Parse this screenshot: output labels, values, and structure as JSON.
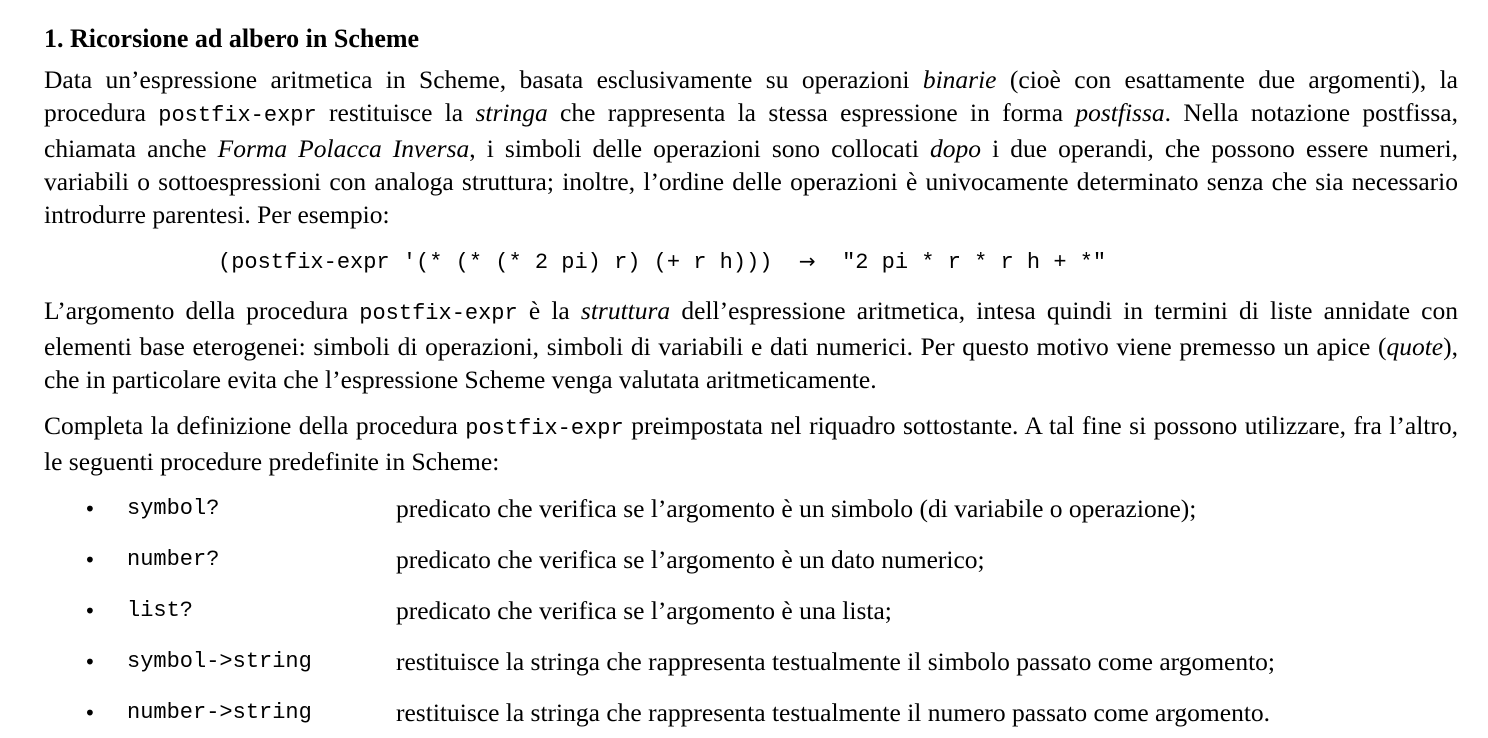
{
  "heading": "1. Ricorsione ad albero in Scheme",
  "p1": {
    "t1": "Data un’espressione aritmetica in Scheme, basata esclusivamente su operazioni ",
    "i1": "binarie",
    "t2": " (cioè con esattamente due argomenti), la procedura ",
    "c1": "postfix-expr",
    "t3": " restituisce la ",
    "i2": "stringa",
    "t4": " che rappresenta la stessa espressione in forma ",
    "i3": "postfissa",
    "t5": ". Nella notazione postfissa, chiamata anche ",
    "i4": "Forma Polacca Inversa",
    "t6": ", i simboli delle operazioni sono collocati ",
    "i5": "dopo",
    "t7": " i due operandi, che possono essere numeri, variabili o sottoespressioni con analoga struttura; inoltre, l’ordine delle operazioni è univocamente determinato senza che sia necessario introdurre parentesi. Per esempio:"
  },
  "example": {
    "code": "(postfix-expr '(* (* (* 2 pi) r) (+ r h)))",
    "arrow": "→",
    "result": "\"2 pi * r * r h + *\""
  },
  "p2": {
    "t1": "L’argomento della procedura ",
    "c1": "postfix-expr",
    "t2": " è la ",
    "i1": "struttura",
    "t3": " dell’espressione aritmetica, intesa quindi in termini di liste annidate con elementi base eterogenei: simboli di operazioni, simboli di variabili e dati numerici. Per questo motivo viene premesso un apice (",
    "i2": "quote",
    "t4": "), che in particolare evita che l’espressione Scheme venga valutata aritmeticamente."
  },
  "p3": {
    "t1": "Completa la definizione della procedura ",
    "c1": "postfix-expr",
    "t2": " preimpostata nel riquadro sottostante. A tal fine si possono utilizzare, fra l’altro, le seguenti procedure predefinite in Scheme:"
  },
  "procedures": [
    {
      "bullet": "•",
      "name": "symbol?",
      "desc": "predicato che verifica se l’argomento è un simbolo (di variabile o operazione);"
    },
    {
      "bullet": "•",
      "name": "number?",
      "desc": "predicato che verifica se l’argomento è un dato numerico;"
    },
    {
      "bullet": "•",
      "name": "list?",
      "desc": "predicato che verifica se l’argomento è una lista;"
    },
    {
      "bullet": "•",
      "name": "symbol->string",
      "desc": "restituisce la stringa che rappresenta testualmente il simbolo passato come argomento;"
    },
    {
      "bullet": "•",
      "name": "number->string",
      "desc": "restituisce la stringa che rappresenta testualmente il numero passato come argomento."
    }
  ]
}
